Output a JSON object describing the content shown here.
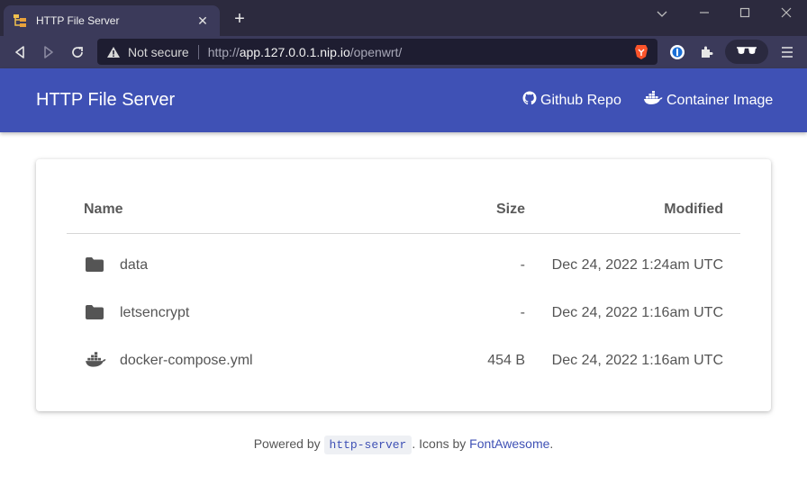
{
  "browser": {
    "tab_title": "HTTP File Server",
    "close_glyph": "✕",
    "new_tab_glyph": "+",
    "omnibox": {
      "security_label": "Not secure",
      "url_scheme": "http://",
      "url_host": "app.127.0.0.1.nip.io",
      "url_path": "/openwrt/"
    }
  },
  "app": {
    "title": "HTTP File Server",
    "links": [
      {
        "label": "Github Repo",
        "icon": "github-icon"
      },
      {
        "label": "Container Image",
        "icon": "docker-icon"
      }
    ]
  },
  "table": {
    "columns": [
      "Name",
      "Size",
      "Modified"
    ],
    "rows": [
      {
        "name": "data",
        "size": "-",
        "modified": "Dec 24, 2022 1:24am UTC",
        "icon": "folder-icon"
      },
      {
        "name": "letsencrypt",
        "size": "-",
        "modified": "Dec 24, 2022 1:16am UTC",
        "icon": "folder-icon"
      },
      {
        "name": "docker-compose.yml",
        "size": "454 B",
        "modified": "Dec 24, 2022 1:16am UTC",
        "icon": "docker-icon"
      }
    ]
  },
  "footer": {
    "prefix": "Powered by ",
    "code": "http-server",
    "middle": ". Icons by ",
    "link": "FontAwesome",
    "suffix": "."
  },
  "colors": {
    "appbar": "#3f51b5",
    "chrome": "#3b3a5a",
    "link": "#3f51b5"
  }
}
